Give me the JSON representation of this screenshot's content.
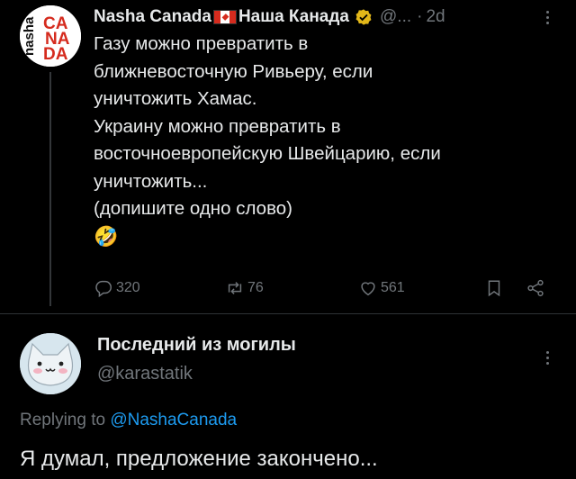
{
  "post": {
    "author_name": "Nasha Canada",
    "author_name_ru": "Наша Канада",
    "handle": "@...",
    "separator": "·",
    "time": "2d",
    "avatar_lines": [
      "CA",
      "NA",
      "DA"
    ],
    "avatar_side": "nasha",
    "lines": [
      "Газу можно превратить в",
      "ближневосточную Ривьеру, если",
      "уничтожить Хамас.",
      "Украину можно превратить в",
      "восточноевропейскую Швейцарию, если",
      "уничтожить...",
      "(допишите одно слово)"
    ],
    "emoji": "🤣",
    "replies_count": "320",
    "reposts_count": "76",
    "likes_count": "561"
  },
  "reply": {
    "name": "Последний из могилы",
    "handle": "@karastatik",
    "replying_prefix": "Replying to",
    "replying_to": "@NashaCanada",
    "text": "Я думал, предложение закончено..."
  },
  "colors": {
    "background": "#000000",
    "text": "#e7e9ea",
    "muted": "#71767b",
    "link": "#1d9bf0",
    "verified_gold": "#e2b719",
    "brand_red": "#d52b1e"
  },
  "icons": [
    "verified-icon",
    "more-icon",
    "reply-icon",
    "repost-icon",
    "like-icon",
    "bookmark-icon",
    "share-icon",
    "canada-flag-icon"
  ]
}
